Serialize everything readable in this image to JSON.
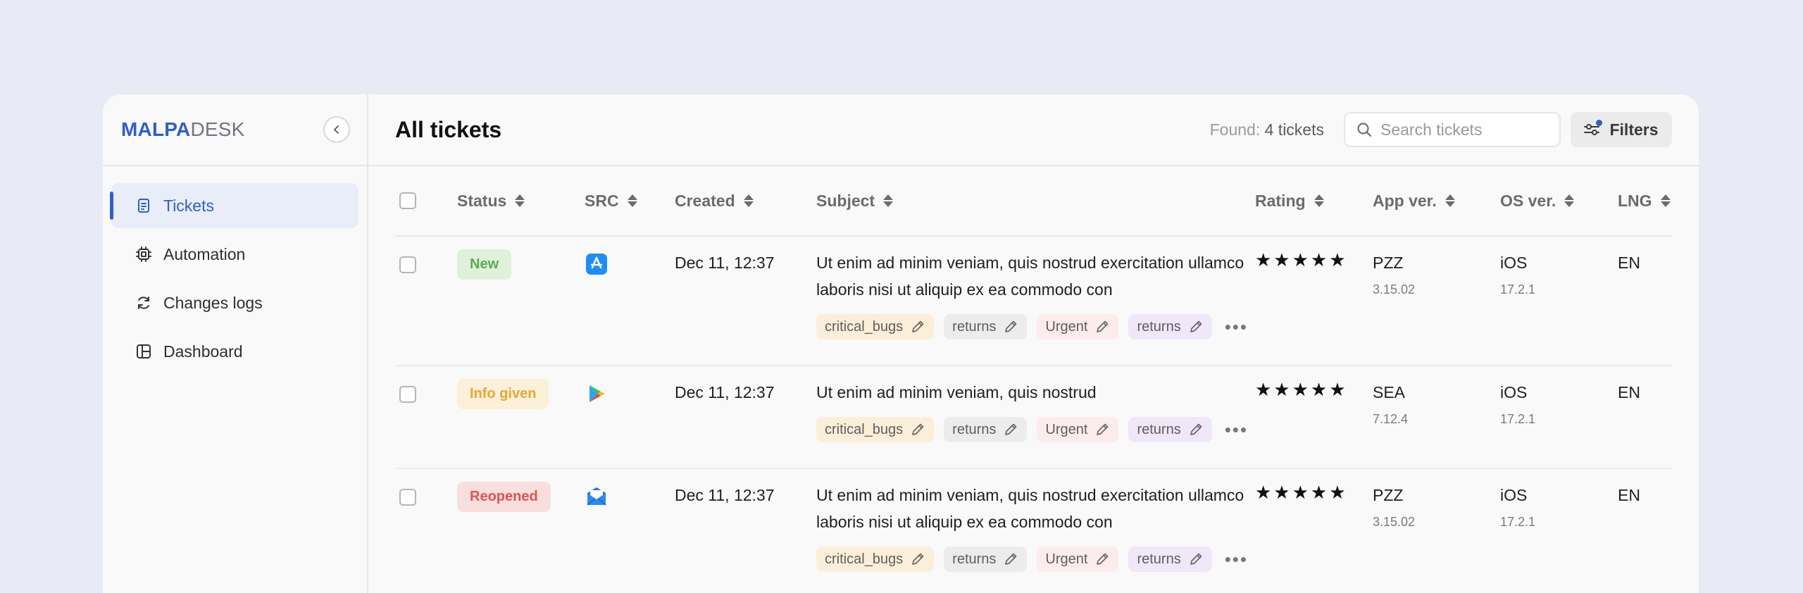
{
  "brand": {
    "part1": "MALPA",
    "part2": "DESK"
  },
  "nav": [
    {
      "label": "Tickets",
      "icon": "document-icon",
      "active": true
    },
    {
      "label": "Automation",
      "icon": "cpu-icon",
      "active": false
    },
    {
      "label": "Changes logs",
      "icon": "refresh-icon",
      "active": false
    },
    {
      "label": "Dashboard",
      "icon": "layout-icon",
      "active": false
    }
  ],
  "header": {
    "title": "All tickets",
    "found_label": "Found:",
    "found_count": "4 tickets",
    "search_placeholder": "Search tickets",
    "filters_label": "Filters"
  },
  "columns": [
    "Status",
    "SRC",
    "Created",
    "Subject",
    "Rating",
    "App ver.",
    "OS ver.",
    "LNG"
  ],
  "rows": [
    {
      "status": "New",
      "status_kind": "new",
      "src": "app-store-icon",
      "created": "Dec 11, 12:37",
      "subject": "Ut enim ad minim veniam, quis nostrud exercitation ullamco laboris nisi ut aliquip ex ea commodo con",
      "tags": [
        {
          "label": "critical_bugs",
          "color": "orange"
        },
        {
          "label": "returns",
          "color": "gray"
        },
        {
          "label": "Urgent",
          "color": "pink"
        },
        {
          "label": "returns",
          "color": "purple"
        }
      ],
      "rating": "★★★★★",
      "app": "PZZ",
      "app_ver": "3.15.02",
      "os": "iOS",
      "os_ver": "17.2.1",
      "lng": "EN"
    },
    {
      "status": "Info given",
      "status_kind": "info",
      "src": "google-play-icon",
      "created": "Dec 11, 12:37",
      "subject": "Ut enim ad minim veniam, quis nostrud",
      "tags": [
        {
          "label": "critical_bugs",
          "color": "orange"
        },
        {
          "label": "returns",
          "color": "gray"
        },
        {
          "label": "Urgent",
          "color": "pink"
        },
        {
          "label": "returns",
          "color": "purple"
        }
      ],
      "rating": "★★★★★",
      "app": "SEA",
      "app_ver": "7.12.4",
      "os": "iOS",
      "os_ver": "17.2.1",
      "lng": "EN"
    },
    {
      "status": "Reopened",
      "status_kind": "reopened",
      "src": "email-icon",
      "created": "Dec 11, 12:37",
      "subject": "Ut enim ad minim veniam, quis nostrud exercitation ullamco laboris nisi ut aliquip ex ea commodo con",
      "tags": [
        {
          "label": "critical_bugs",
          "color": "orange"
        },
        {
          "label": "returns",
          "color": "gray"
        },
        {
          "label": "Urgent",
          "color": "pink"
        },
        {
          "label": "returns",
          "color": "purple"
        }
      ],
      "rating": "★★★★★",
      "app": "PZZ",
      "app_ver": "3.15.02",
      "os": "iOS",
      "os_ver": "17.2.1",
      "lng": "EN"
    }
  ],
  "colors": {
    "accent": "#2f5fc6",
    "background": "#e8eaf6",
    "panel": "#f9f9f9"
  }
}
